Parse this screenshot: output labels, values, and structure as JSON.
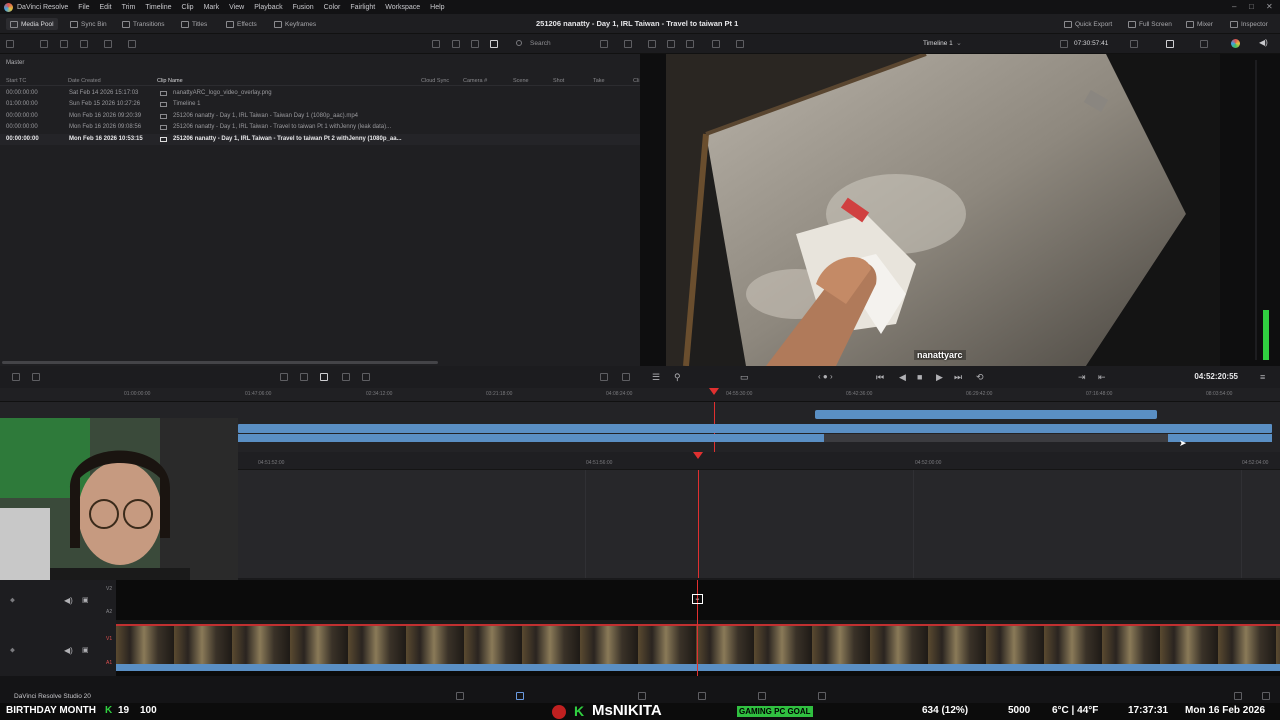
{
  "menubar": {
    "app_name": "DaVinci Resolve",
    "items": [
      "File",
      "Edit",
      "Trim",
      "Timeline",
      "Clip",
      "Mark",
      "View",
      "Playback",
      "Fusion",
      "Color",
      "Fairlight",
      "Workspace",
      "Help"
    ]
  },
  "toolbar": {
    "media_pool": "Media Pool",
    "sync_bin": "Sync Bin",
    "transitions": "Transitions",
    "titles": "Titles",
    "effects": "Effects",
    "keyframes": "Keyframes",
    "project_title": "251206  nanatty - Day 1, IRL Taiwan - Travel to taiwan Pt 1",
    "quick_export": "Quick Export",
    "full_screen": "Full Screen",
    "mixer": "Mixer",
    "inspector": "Inspector"
  },
  "mediapool_toolbar": {
    "search_placeholder": "Search"
  },
  "viewer_toolbar": {
    "timeline_name": "Timeline 1",
    "source_timecode": "07:30:57:41"
  },
  "mediapool": {
    "bin_name": "Master",
    "columns": [
      "Start TC",
      "Date Created",
      "Clip Name",
      "Cloud Sync",
      "Camera #",
      "Scene",
      "Shot",
      "Take",
      "Cli"
    ],
    "rows": [
      {
        "start_tc": "00:00:00:00",
        "date": "Sat Feb 14 2026 15:17:03",
        "name": "nanattyARC_logo_video_overlay.png",
        "selected": false
      },
      {
        "start_tc": "01:00:00:00",
        "date": "Sun Feb 15 2026 10:27:26",
        "name": "Timeline 1",
        "selected": false
      },
      {
        "start_tc": "00:00:00:00",
        "date": "Mon Feb 16 2026 09:20:39",
        "name": "251206  nanatty - Day 1, IRL Taiwan - Taiwan Day 1 (1080p_aac).mp4",
        "selected": false
      },
      {
        "start_tc": "00:00:00:00",
        "date": "Mon Feb 16 2026 09:08:56",
        "name": "251206  nanatty - Day 1, IRL Taiwan - Travel to taiwan Pt 1 withJenny (leak data)...",
        "selected": false
      },
      {
        "start_tc": "00:00:00:00",
        "date": "Mon Feb 16 2026 10:53:15",
        "name": "251206  nanatty - Day 1, IRL Taiwan - Travel to taiwan Pt 2 withJenny (1080p_aa...",
        "selected": true
      }
    ]
  },
  "viewer": {
    "watermark": "nanattyarc",
    "timecode": "04:52:20:55"
  },
  "timeline": {
    "ruler_top": [
      "01:00:00:00",
      "01:47:06:00",
      "02:34:12:00",
      "03:21:18:00",
      "04:08:24:00",
      "04:55:30:00",
      "05:42:36:00",
      "06:29:42:00",
      "07:16:48:00",
      "08:03:54:00"
    ],
    "ruler_zoom": [
      "04:51:52:00",
      "04:51:56:00",
      "04:52:00:00",
      "04:52:04:00"
    ],
    "tracks": [
      "V2",
      "A2",
      "V1",
      "A1"
    ]
  },
  "bottombar": {
    "app_label": "DaVinci Resolve Studio 20"
  },
  "overlay": {
    "left_text": "BIRTHDAY MONTH",
    "count_a": "19",
    "count_b": "100",
    "channel": "MsNIKITA",
    "goal_label": "GAMING PC GOAL",
    "goal_value": "634 (12%)",
    "goal_target": "5000",
    "weather": "6°C | 44°F",
    "time": "17:37:31",
    "date": "Mon 16 Feb 2026"
  },
  "colors": {
    "accent_blue": "#5a8fc4",
    "playhead_red": "#e03030",
    "meter_green": "#30d040"
  }
}
